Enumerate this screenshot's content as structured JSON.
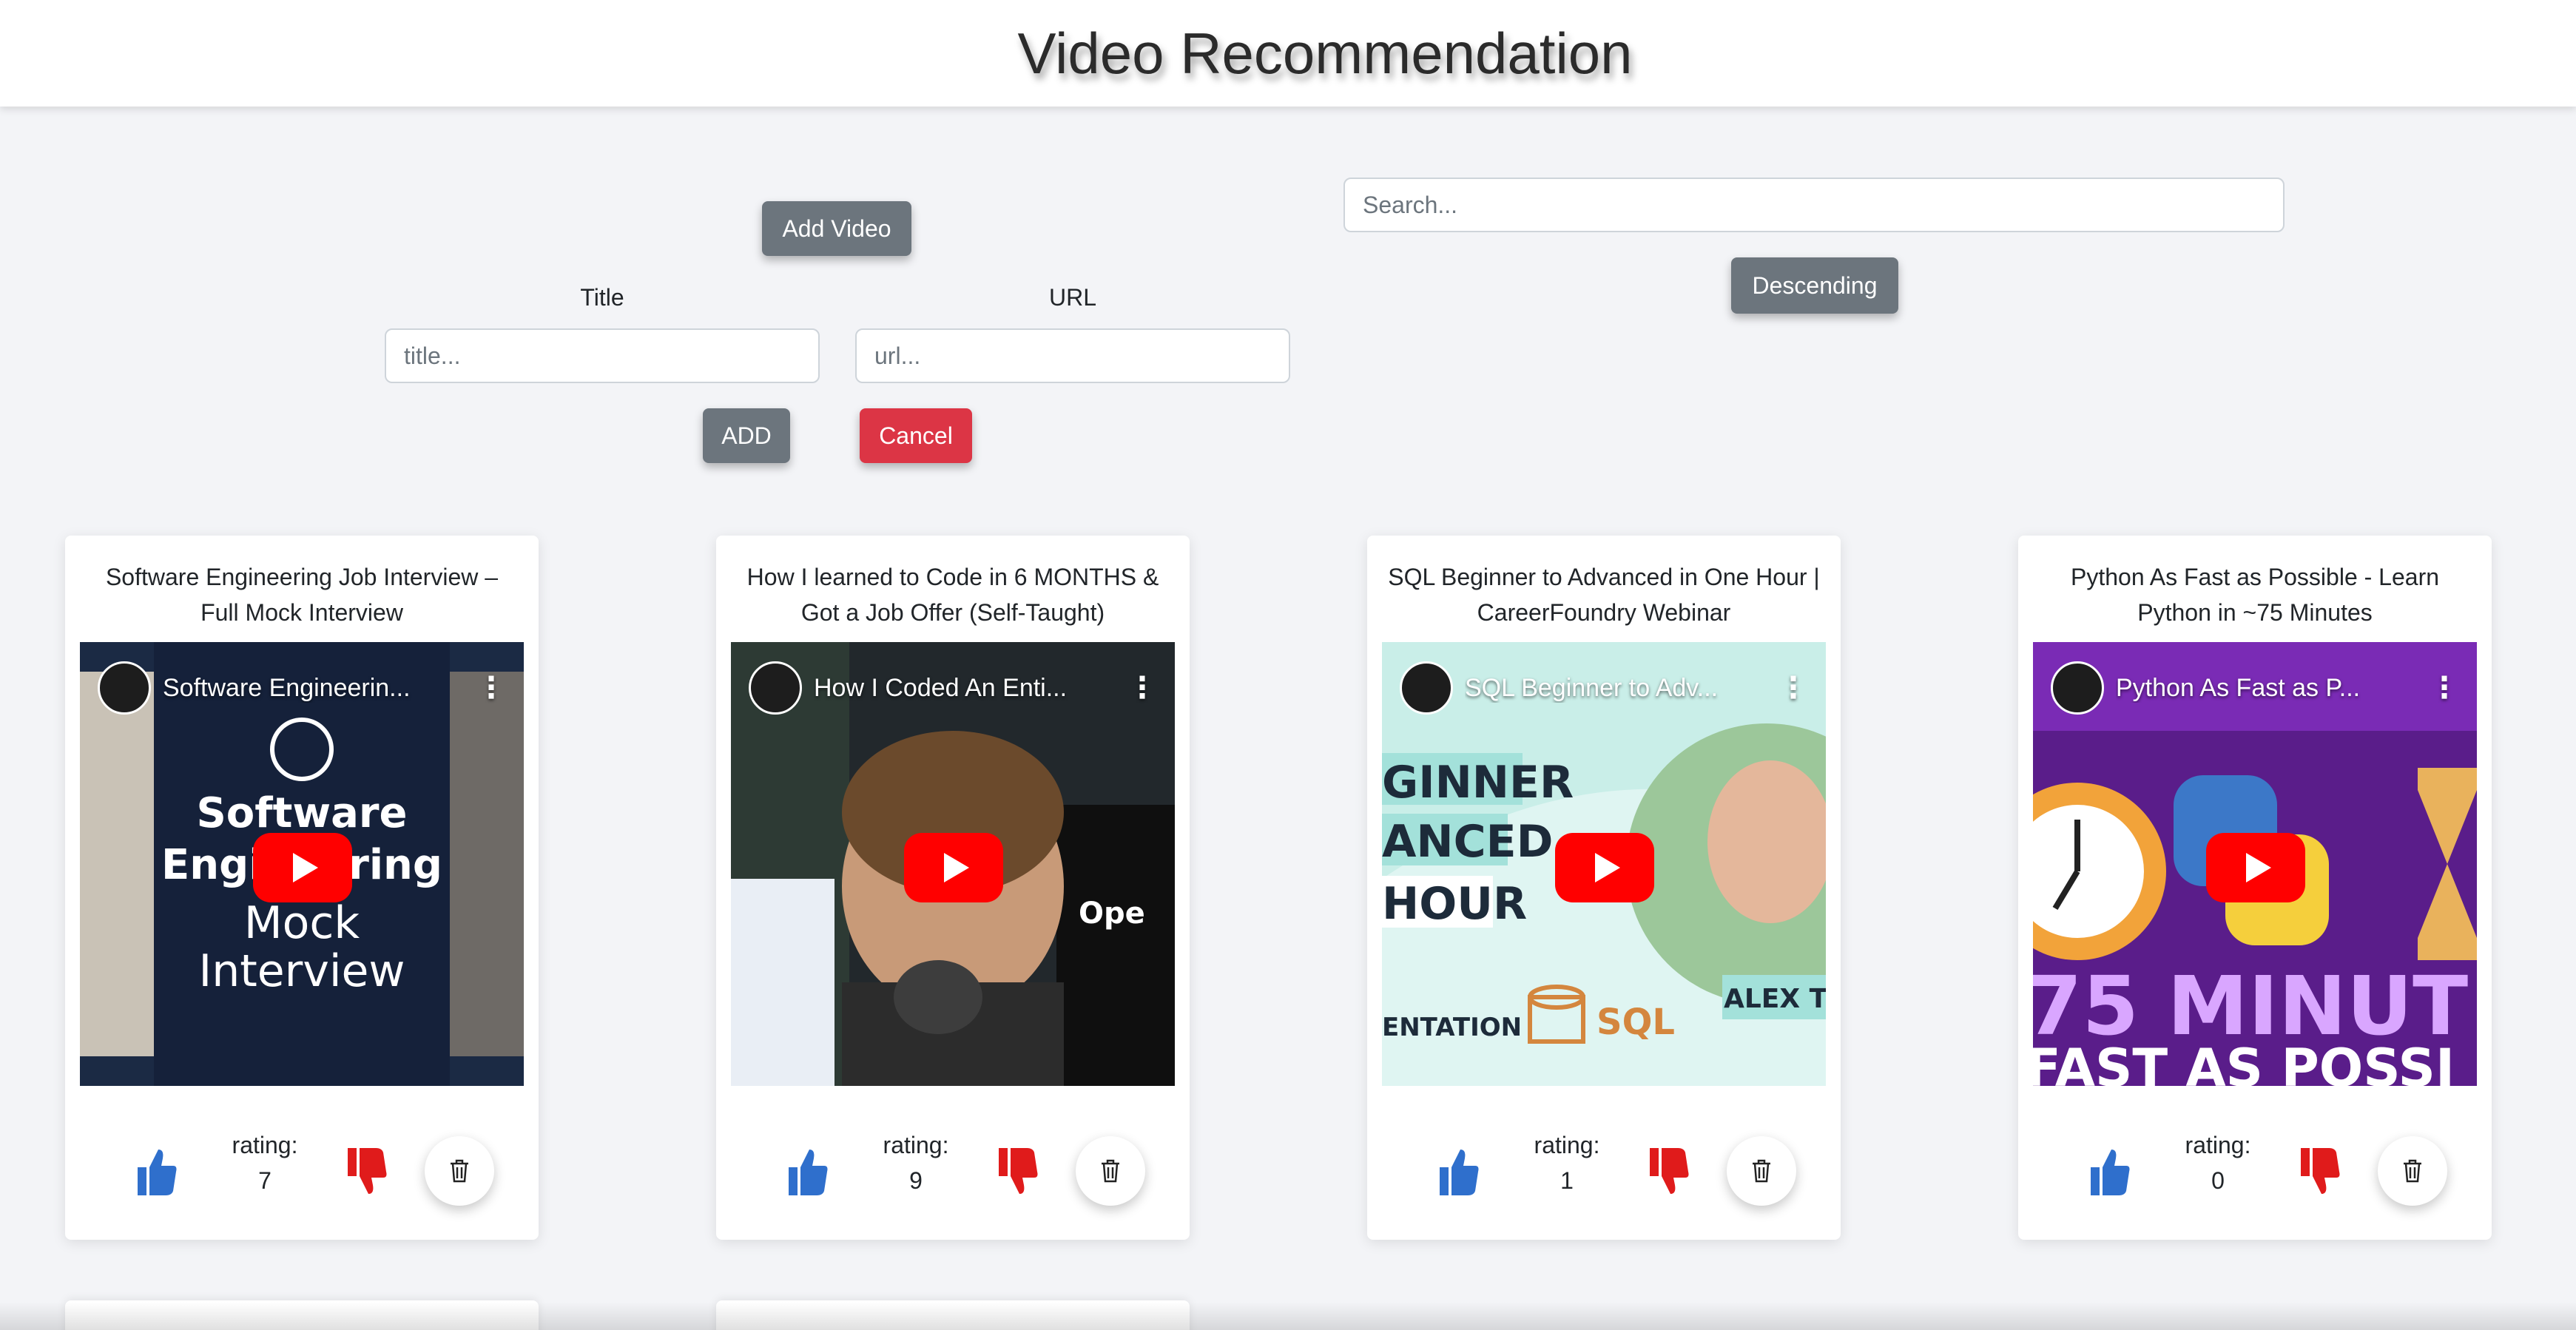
{
  "header": {
    "title": "Video Recommendation"
  },
  "add_form": {
    "toggle_label": "Add Video",
    "title_label": "Title",
    "url_label": "URL",
    "title_placeholder": "title...",
    "url_placeholder": "url...",
    "add_label": "ADD",
    "cancel_label": "Cancel"
  },
  "search": {
    "placeholder": "Search...",
    "sort_label": "Descending"
  },
  "colors": {
    "primary_gray": "#6c757d",
    "danger_red": "#dc3545",
    "like_blue": "#2f6fcc",
    "dislike_red": "#e01b1b",
    "play_red": "#ff0000"
  },
  "videos": [
    {
      "title": "Software Engineering Job Interview – Full Mock Interview",
      "thumbnail_caption": "Software Engineerin...",
      "rating_label": "rating:",
      "rating": "7"
    },
    {
      "title": "How I learned to Code in 6 MONTHS & Got a Job Offer (Self-Taught)",
      "thumbnail_caption": "How I Coded An Enti...",
      "rating_label": "rating:",
      "rating": "9"
    },
    {
      "title": "SQL Beginner to Advanced in One Hour | CareerFoundry Webinar",
      "thumbnail_caption": "SQL Beginner to Adv...",
      "rating_label": "rating:",
      "rating": "1"
    },
    {
      "title": "Python As Fast as Possible - Learn Python in ~75 Minutes",
      "thumbnail_caption": "Python As Fast as P...",
      "rating_label": "rating:",
      "rating": "0"
    }
  ]
}
